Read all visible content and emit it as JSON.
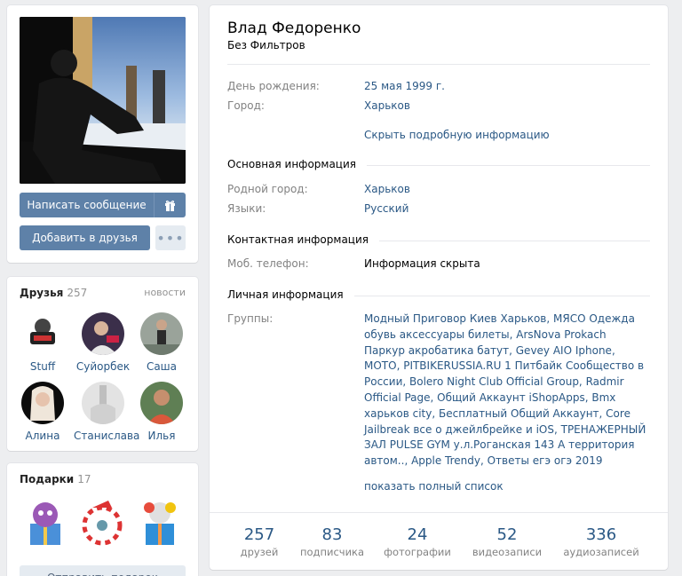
{
  "profile": {
    "name": "Влад Федоренко",
    "status": "Без Фильтров"
  },
  "actions": {
    "message_label": "Написать сообщение",
    "add_friend_label": "Добавить в друзья",
    "more_label": "•••"
  },
  "info": {
    "birthday_label": "День рождения:",
    "birthday_value": "25 мая 1999 г.",
    "city_label": "Город:",
    "city_value": "Харьков",
    "hide_details": "Скрыть подробную информацию"
  },
  "main_section": {
    "title": "Основная информация",
    "hometown_label": "Родной город:",
    "hometown_value": "Харьков",
    "languages_label": "Языки:",
    "languages_value": "Русский"
  },
  "contact_section": {
    "title": "Контактная информация",
    "phone_label": "Моб. телефон:",
    "phone_value": "Информация скрыта"
  },
  "personal_section": {
    "title": "Личная информация",
    "groups_label": "Группы:",
    "groups_value": "Модный Приговор Киев Харьков, МЯСО Одежда обувь аксессуары билеты, ArsNova Prokach Паркур акробатика батут, Gevey AIO Iphone, MOTO, PITBIKERUSSIA.RU 1 Питбайк Сообщество в России, Bolero Night Club Official Group, Radmir Official Page, Общий Аккаунт iShopApps, Bmx харьков city, Бесплатный Общий Аккаунт, Core Jailbreak все о джейлбрейке и iOS, ТРЕНАЖЕРНЫЙ ЗАЛ PULSE GYM у.л.Роганская 143 А территория автом.., Apple Trendy, Ответы егэ огэ 2019",
    "show_full": "показать полный список"
  },
  "counters": [
    {
      "value": "257",
      "label": "друзей"
    },
    {
      "value": "83",
      "label": "подписчика"
    },
    {
      "value": "24",
      "label": "фотографии"
    },
    {
      "value": "52",
      "label": "видеозаписи"
    },
    {
      "value": "336",
      "label": "аудиозаписей"
    }
  ],
  "friends": {
    "title": "Друзья",
    "count": "257",
    "news_label": "новости",
    "items": [
      {
        "name": "Stuff"
      },
      {
        "name": "Суйорбек"
      },
      {
        "name": "Саша"
      },
      {
        "name": "Алина"
      },
      {
        "name": "Станислава"
      },
      {
        "name": "Илья"
      }
    ]
  },
  "gifts": {
    "title": "Подарки",
    "count": "17",
    "send_label": "Отправить подарок"
  },
  "colors": {
    "accent": "#5e81a8",
    "link": "#2a5885",
    "background": "#edeef0"
  }
}
